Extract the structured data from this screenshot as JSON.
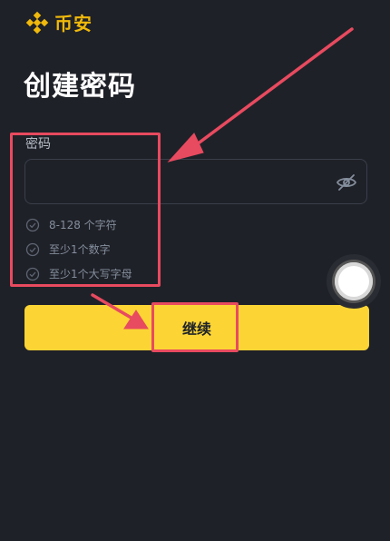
{
  "brand": {
    "name": "币安",
    "logo_icon": "binance-diamond-logo-icon",
    "color": "#f0b90b"
  },
  "page": {
    "title": "创建密码"
  },
  "password": {
    "label": "密码",
    "value": "",
    "placeholder": "",
    "toggle_icon": "eye-off-icon"
  },
  "rules": [
    {
      "text": "8-128 个字符",
      "icon": "check-circle-icon"
    },
    {
      "text": "至少1个数字",
      "icon": "check-circle-icon"
    },
    {
      "text": "至少1个大写字母",
      "icon": "check-circle-icon"
    }
  ],
  "continue_button": {
    "label": "继续",
    "color": "#fcd535"
  },
  "assistive_touch": {
    "icon": "assistive-touch-icon"
  },
  "annotations": {
    "color": "#e84a5f"
  }
}
